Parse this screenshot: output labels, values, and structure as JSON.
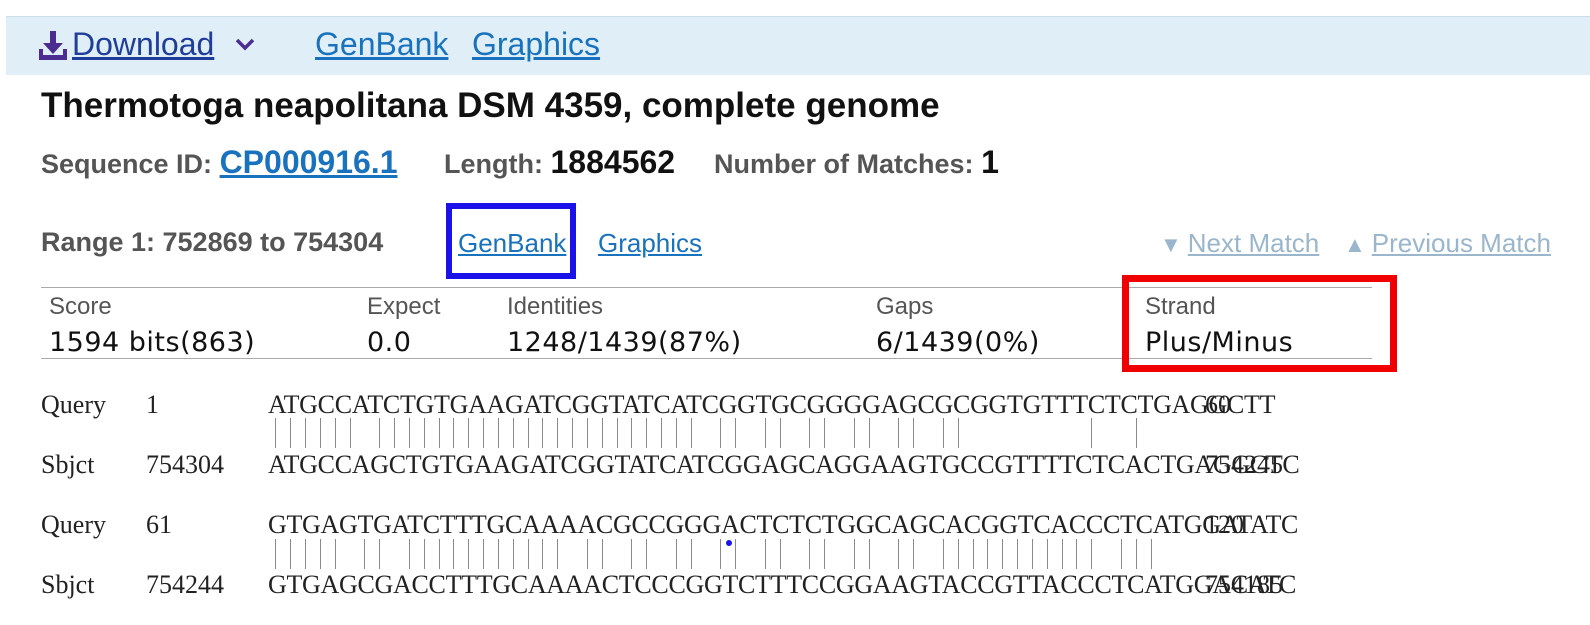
{
  "toolbar": {
    "download_label": "Download",
    "genbank_label": "GenBank",
    "graphics_label": "Graphics"
  },
  "title": "Thermotoga neapolitana DSM 4359, complete genome",
  "meta": {
    "seq_id_label": "Sequence ID:",
    "seq_id": "CP000916.1",
    "length_label": "Length:",
    "length": "1884562",
    "matches_label": "Number of Matches:",
    "matches": "1"
  },
  "range": {
    "label": "Range 1: 752869 to 754304",
    "genbank_label": "GenBank",
    "graphics_label": "Graphics",
    "next_label": "Next Match",
    "prev_label": "Previous Match"
  },
  "stats": {
    "headers": [
      "Score",
      "Expect",
      "Identities",
      "Gaps",
      "Strand"
    ],
    "values": [
      "1594 bits(863)",
      "0.0",
      "1248/1439(87%)",
      "6/1439(0%)",
      "Plus/Minus"
    ]
  },
  "alignment": [
    {
      "q_label": "Query",
      "q_start": "1",
      "q_seq": "ATGCCATCTGTGAAGATCGGTATCATCGGTGCGGGGAGCGCGGTGTTTCTCTGAGGCTT",
      "q_end": "60",
      "s_label": "Sbjct",
      "s_start": "754304",
      "s_seq": "ATGCCAGCTGTGAAGATCGGTATCATCGGAGCAGGAAGTGCCGTTTTCTCACTGAGGCTC",
      "s_end": "754245"
    },
    {
      "q_label": "Query",
      "q_start": "61",
      "q_seq": "GTGAGTGATCTTTGCAAAACGCCGGGACTCTCTGGCAGCACGGTCACCCTCATGGATATC",
      "q_end": "120",
      "s_label": "Sbjct",
      "s_start": "754244",
      "s_seq": "GTGAGCGACCTTTGCAAAACTCCCGGTCTTTCCGGAAGTACCGTTACCCTCATGGACATC",
      "s_end": "754185"
    }
  ],
  "colors": {
    "link": "#1872bd",
    "highlight_blue": "#1a12e8",
    "highlight_red": "#f00000",
    "toolbar_bg": "#e0eff7"
  },
  "icons": [
    "download-icon",
    "chevron-down-icon",
    "triangle-down-icon",
    "triangle-up-icon"
  ]
}
